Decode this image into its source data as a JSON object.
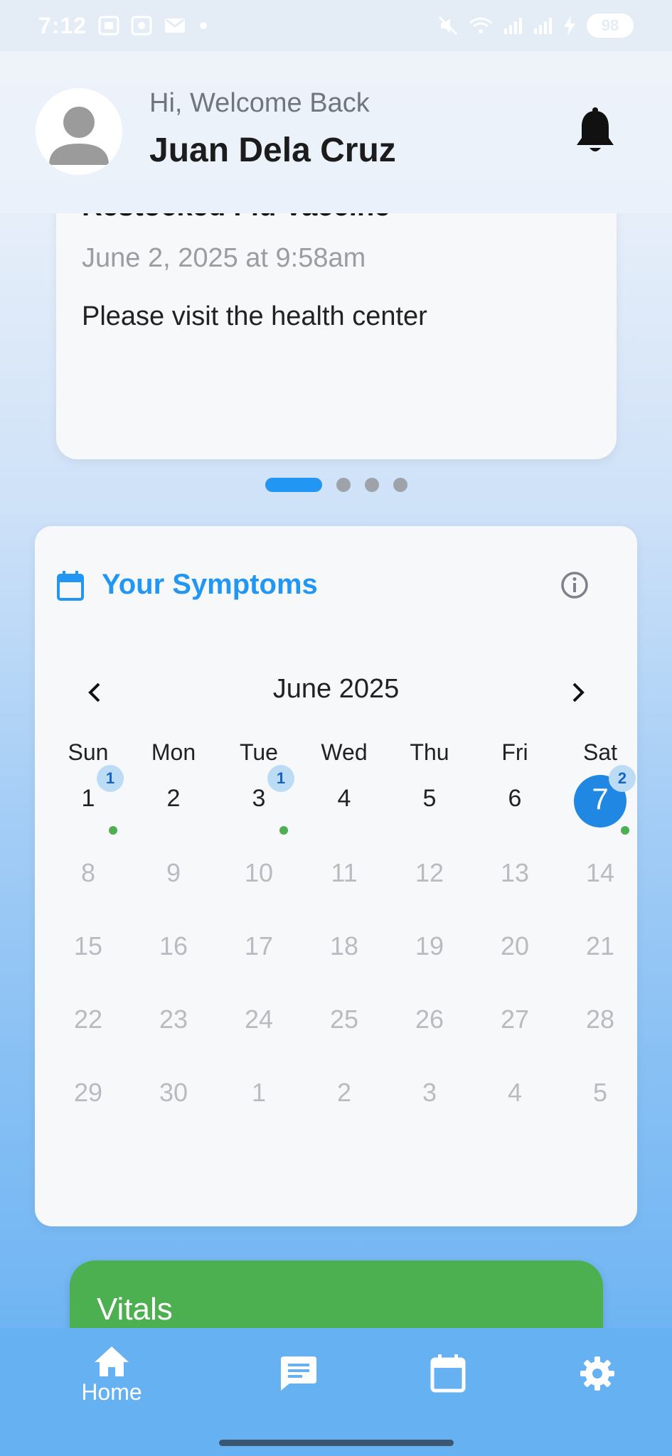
{
  "status_bar": {
    "time": "7:12",
    "battery": "98"
  },
  "header": {
    "greeting": "Hi, Welcome Back",
    "user_name": "Juan Dela Cruz"
  },
  "announcement": {
    "title": "Restocked Flu Vaccine",
    "date": "June 2, 2025 at 9:58am",
    "body": "Please visit the health center",
    "page_count": 4,
    "active_page": 1
  },
  "symptoms": {
    "title": "Your Symptoms",
    "month": "June 2025",
    "weekdays": [
      "Sun",
      "Mon",
      "Tue",
      "Wed",
      "Thu",
      "Fri",
      "Sat"
    ],
    "weeks": [
      [
        {
          "d": "1",
          "badge": "1",
          "dot": true
        },
        {
          "d": "2"
        },
        {
          "d": "3",
          "badge": "1",
          "dot": true
        },
        {
          "d": "4"
        },
        {
          "d": "5"
        },
        {
          "d": "6"
        },
        {
          "d": "7",
          "badge": "2",
          "dot": true,
          "selected": true
        }
      ],
      [
        {
          "d": "8",
          "muted": true
        },
        {
          "d": "9",
          "muted": true
        },
        {
          "d": "10",
          "muted": true
        },
        {
          "d": "11",
          "muted": true
        },
        {
          "d": "12",
          "muted": true
        },
        {
          "d": "13",
          "muted": true
        },
        {
          "d": "14",
          "muted": true
        }
      ],
      [
        {
          "d": "15",
          "muted": true
        },
        {
          "d": "16",
          "muted": true
        },
        {
          "d": "17",
          "muted": true
        },
        {
          "d": "18",
          "muted": true
        },
        {
          "d": "19",
          "muted": true
        },
        {
          "d": "20",
          "muted": true
        },
        {
          "d": "21",
          "muted": true
        }
      ],
      [
        {
          "d": "22",
          "muted": true
        },
        {
          "d": "23",
          "muted": true
        },
        {
          "d": "24",
          "muted": true
        },
        {
          "d": "25",
          "muted": true
        },
        {
          "d": "26",
          "muted": true
        },
        {
          "d": "27",
          "muted": true
        },
        {
          "d": "28",
          "muted": true
        }
      ],
      [
        {
          "d": "29",
          "muted": true
        },
        {
          "d": "30",
          "muted": true
        },
        {
          "d": "1",
          "muted": true
        },
        {
          "d": "2",
          "muted": true
        },
        {
          "d": "3",
          "muted": true
        },
        {
          "d": "4",
          "muted": true
        },
        {
          "d": "5",
          "muted": true
        }
      ]
    ]
  },
  "vitals": {
    "title": "Vitals"
  },
  "bottom_nav": {
    "home_label": "Home",
    "icons": [
      "home-icon",
      "chat-icon",
      "calendar-icon",
      "settings-icon"
    ]
  },
  "colors": {
    "accent": "#2196f3",
    "selected_day": "#2088e2",
    "vitals": "#4caf50",
    "nav_background": "#66b1f2"
  }
}
